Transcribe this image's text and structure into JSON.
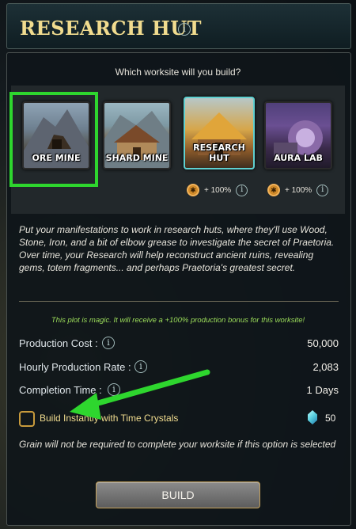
{
  "header": {
    "title": "RESEARCH HUT"
  },
  "prompt": "Which worksite will you build?",
  "worksites": [
    {
      "label": "ORE MINE",
      "selected": true
    },
    {
      "label": "SHARD MINE"
    },
    {
      "label": "RESEARCH HUT",
      "bonus": "+ 100%"
    },
    {
      "label": "AURA LAB",
      "bonus": "+ 100%"
    }
  ],
  "description": "Put your manifestations to work in research huts, where they'll use Wood, Stone, Iron, and a bit of elbow grease to investigate the secret of Praetoria. Over time, your Research will help reconstruct ancient ruins, revealing gems, totem fragments... and perhaps Praetoria's greatest secret.",
  "magic_note": "This plot is magic. It will receive a +100% production bonus for this worksite!",
  "stats": {
    "production_cost_label": "Production Cost :",
    "production_cost_value": "50,000",
    "hourly_rate_label": "Hourly Production Rate :",
    "hourly_rate_value": "2,083",
    "completion_label": "Completion Time :",
    "completion_value": "1 Days"
  },
  "instant": {
    "label": "Build Instantly with Time Crystals",
    "crystal_count": "50",
    "checked": false
  },
  "note": "Grain will not be required to complete your worksite if this option is selected",
  "build_button": "BUILD",
  "colors": {
    "highlight": "#2ed62e",
    "title_gold": "#f1dc8f",
    "selected_tile_border": "#5fd0d0"
  },
  "icons": [
    "info-icon",
    "gear-icon",
    "time-crystal-icon",
    "pointer-arrow"
  ]
}
